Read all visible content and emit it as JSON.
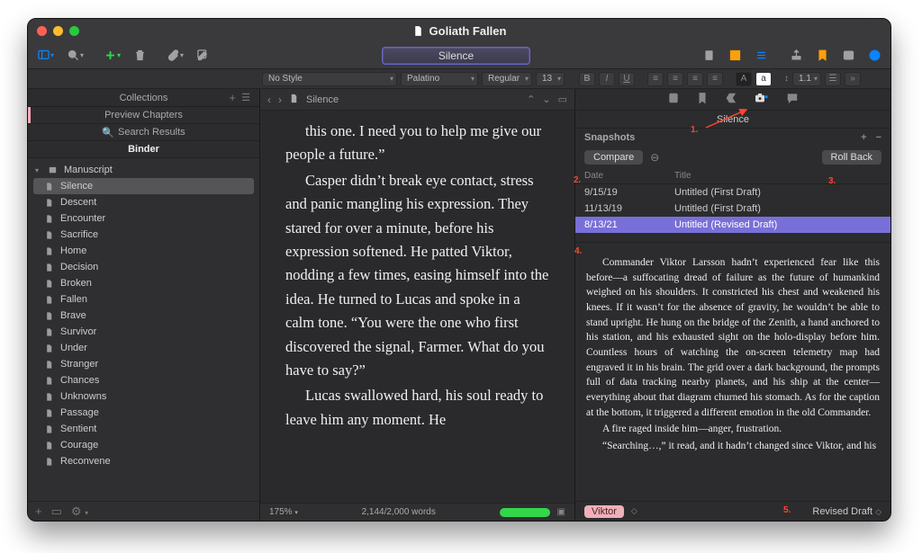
{
  "window_title": "Goliath Fallen",
  "toolbar_pill": "Silence",
  "format": {
    "style": "No Style",
    "font": "Palatino",
    "weight": "Regular",
    "size": "13",
    "line": "1.1"
  },
  "sidebar": {
    "collections_label": "Collections",
    "preview_label": "Preview Chapters",
    "search_label": "Search Results",
    "binder_label": "Binder",
    "root": "Manuscript",
    "items": [
      {
        "label": "Silence",
        "selected": true
      },
      {
        "label": "Descent"
      },
      {
        "label": "Encounter"
      },
      {
        "label": "Sacrifice"
      },
      {
        "label": "Home"
      },
      {
        "label": "Decision"
      },
      {
        "label": "Broken"
      },
      {
        "label": "Fallen"
      },
      {
        "label": "Brave"
      },
      {
        "label": "Survivor"
      },
      {
        "label": "Under"
      },
      {
        "label": "Stranger"
      },
      {
        "label": "Chances"
      },
      {
        "label": "Unknowns"
      },
      {
        "label": "Passage"
      },
      {
        "label": "Sentient"
      },
      {
        "label": "Courage"
      },
      {
        "label": "Reconvene"
      }
    ]
  },
  "editor": {
    "doc_title": "Silence",
    "paragraphs": [
      "this one. I need you to help me give our people a future.”",
      "Casper didn’t break eye contact, stress and panic mangling his expression. They stared for over a minute, before his expression softened. He patted Viktor, nodding a few times, easing himself into the idea. He turned to Lucas and spoke in a calm tone. “You were the one who first discovered the signal, Farmer. What do you have to say?”",
      "Lucas swallowed hard, his soul ready to leave him any moment. He"
    ],
    "zoom": "175%",
    "wordcount": "2,144/2,000 words"
  },
  "inspector": {
    "title": "Silence",
    "snapshots_label": "Snapshots",
    "compare_btn": "Compare",
    "rollback_btn": "Roll Back",
    "col_date": "Date",
    "col_title": "Title",
    "rows": [
      {
        "date": "9/15/19",
        "title": "Untitled (First Draft)"
      },
      {
        "date": "11/13/19",
        "title": "Untitled (First Draft)"
      },
      {
        "date": "8/13/21",
        "title": "Untitled (Revised Draft)",
        "selected": true
      }
    ],
    "snapshot_paragraphs": [
      "Commander Viktor Larsson hadn’t experienced fear like this before—a suffocating dread of failure as the future of humankind weighed on his shoulders. It constricted his chest and weakened his knees. If it wasn’t for the absence of gravity, he wouldn’t be able to stand upright. He hung on the bridge of the Zenith, a hand anchored to his station, and his exhausted sight on the holo-display before him. Countless hours of watching the on-screen telemetry map had engraved it in his brain. The grid over a dark background, the prompts full of data tracking nearby planets, and his ship at the center—everything about that diagram churned his stomach. As for the caption at the bottom, it triggered a different emotion in the old Commander.",
      "A fire raged inside him—anger, frustration.",
      "“Searching…,” it read, and it hadn’t changed since Viktor, and his"
    ],
    "pov": "Viktor",
    "revision": "Revised Draft"
  },
  "annotations": {
    "a1": "1.",
    "a2": "2.",
    "a3": "3.",
    "a4": "4.",
    "a5": "5."
  }
}
